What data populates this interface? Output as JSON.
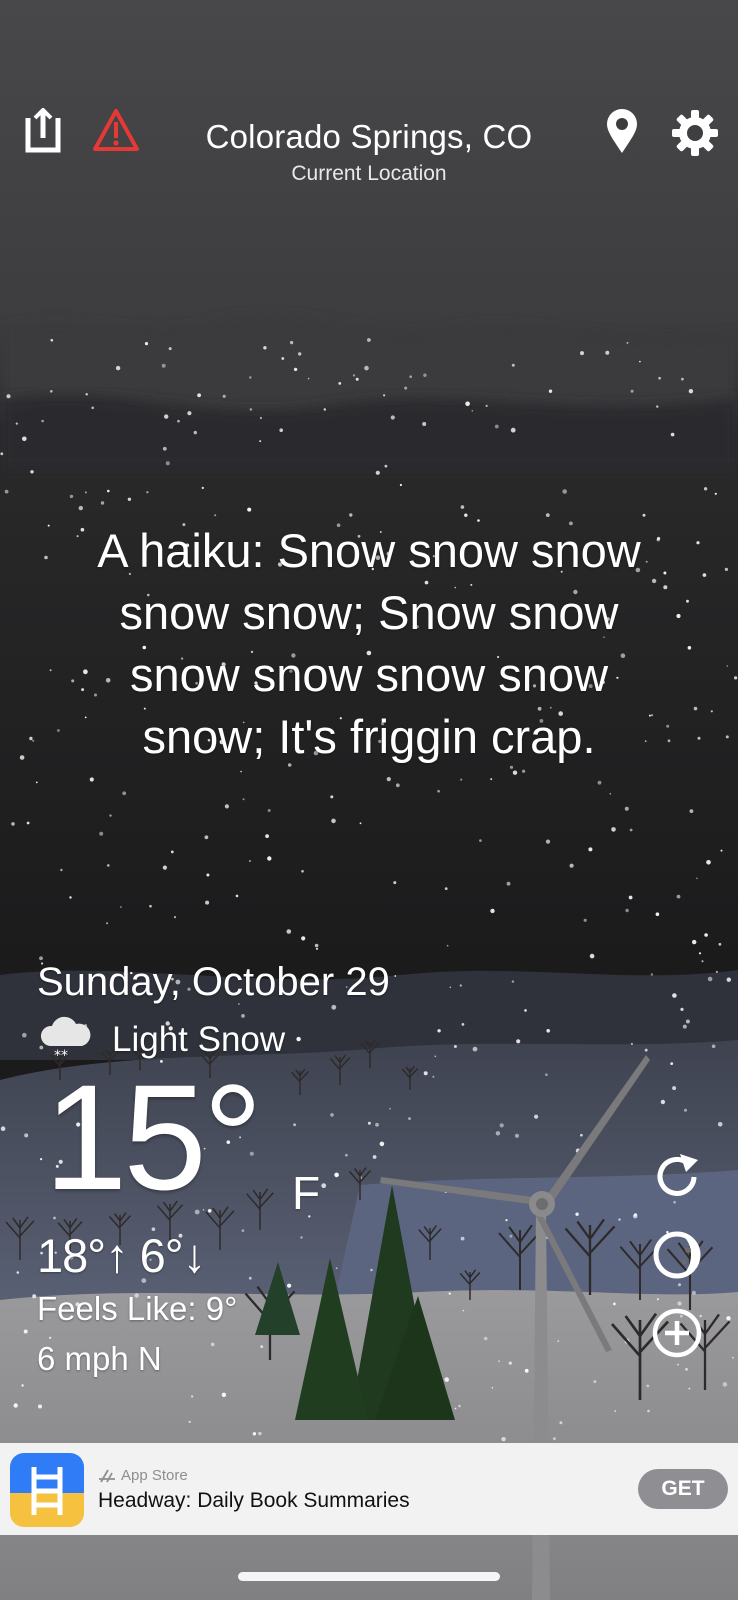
{
  "header": {
    "location": "Colorado Springs, CO",
    "sublabel": "Current Location",
    "icons": [
      "share-icon",
      "alert-triangle-icon",
      "location-pin-icon",
      "gear-icon"
    ]
  },
  "haiku": {
    "lines": [
      "A haiku: Snow snow snow",
      "snow snow; Snow snow",
      "snow snow snow snow",
      "snow; It's friggin crap."
    ]
  },
  "weather": {
    "date": "Sunday, October 29",
    "condition": "Light Snow",
    "condition_icon": "snow-cloud-icon",
    "temperature": "15°",
    "unit": "F",
    "hi_lo": "18°↑ 6°↓",
    "feels_like": "Feels Like: 9°",
    "wind": "6 mph N"
  },
  "side_buttons": [
    "refresh-icon",
    "moon-phase-icon",
    "add-circle-icon"
  ],
  "ad": {
    "source": "App Store",
    "title": "Headway: Daily Book Summaries",
    "cta": "GET"
  },
  "colors": {
    "sky_top": "#47474a",
    "sky_bottom": "#1b1b1b",
    "hills": "#5a6173",
    "snow_ground": "#8f8f92",
    "pine": "#1f3b1f",
    "ad_bg": "#f2f2f2",
    "get_button": "#8e8e93",
    "alert_red": "#e53935"
  }
}
